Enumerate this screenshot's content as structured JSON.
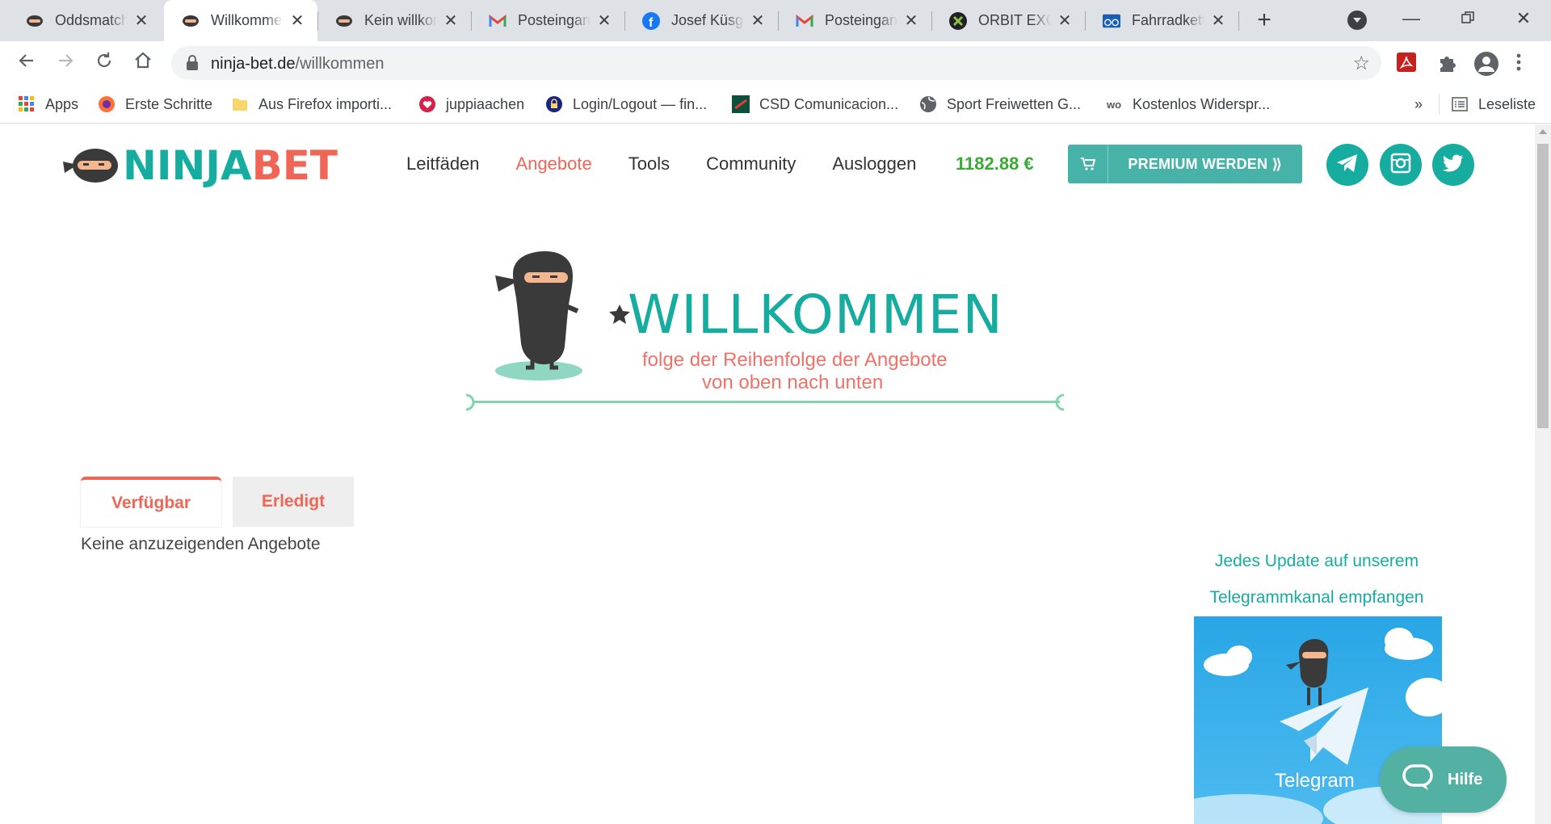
{
  "browser": {
    "tabs": [
      {
        "title": "Oddsmatcher",
        "icon": "ninja-icon"
      },
      {
        "title": "Willkommen",
        "icon": "ninja-icon",
        "active": true
      },
      {
        "title": "Kein willkommen",
        "icon": "ninja-icon"
      },
      {
        "title": "Posteingang",
        "icon": "gmail-icon"
      },
      {
        "title": "Josef Küsgen",
        "icon": "facebook-icon"
      },
      {
        "title": "Posteingang",
        "icon": "gmail-icon"
      },
      {
        "title": "ORBIT EXCH",
        "icon": "orbit-icon"
      },
      {
        "title": "Fahrradkette",
        "icon": "bike-icon"
      }
    ],
    "url_host": "ninja-bet.de",
    "url_path": "/willkommen",
    "bookmarks": [
      {
        "label": "Apps",
        "icon": "apps-grid-icon"
      },
      {
        "label": "Erste Schritte",
        "icon": "firefox-icon"
      },
      {
        "label": "Aus Firefox importi...",
        "icon": "folder-icon"
      },
      {
        "label": "juppiaachen",
        "icon": "heart-icon"
      },
      {
        "label": "Login/Logout — fin...",
        "icon": "lock-icon"
      },
      {
        "label": "CSD Comunicacion...",
        "icon": "csd-icon"
      },
      {
        "label": "Sport Freiwetten G...",
        "icon": "globe-icon"
      },
      {
        "label": "Kostenlos Widerspr...",
        "icon": "wo-icon"
      }
    ],
    "bookmarks_overflow": "»",
    "reading_list": "Leseliste"
  },
  "site": {
    "logo": {
      "part1": "NINJA",
      "part2": "BET"
    },
    "nav": [
      "Leitfäden",
      "Angebote",
      "Tools",
      "Community",
      "Ausloggen"
    ],
    "active_nav": "Angebote",
    "balance": "1182.88 €",
    "premium_label": "PREMIUM WERDEN ⟫",
    "social": [
      "telegram-icon",
      "instagram-icon",
      "twitter-icon"
    ],
    "hero": {
      "title": "WILLKOMMEN",
      "subtitle_line1": "folge der Reihenfolge der Angebote",
      "subtitle_line2": "von oben nach unten"
    },
    "tabs": {
      "available": "Verfügbar",
      "done": "Erledigt"
    },
    "empty_message": "Keine anzuzeigenden Angebote",
    "telegram_promo": {
      "line1": "Jedes Update auf unserem",
      "line2": "Telegrammkanal empfangen",
      "banner_label": "Telegram"
    },
    "help_label": "Hilfe",
    "colors": {
      "teal": "#16aca0",
      "coral": "#ef6657",
      "green_balance": "#3aaa35",
      "premium_bg": "#47b2a7"
    }
  }
}
